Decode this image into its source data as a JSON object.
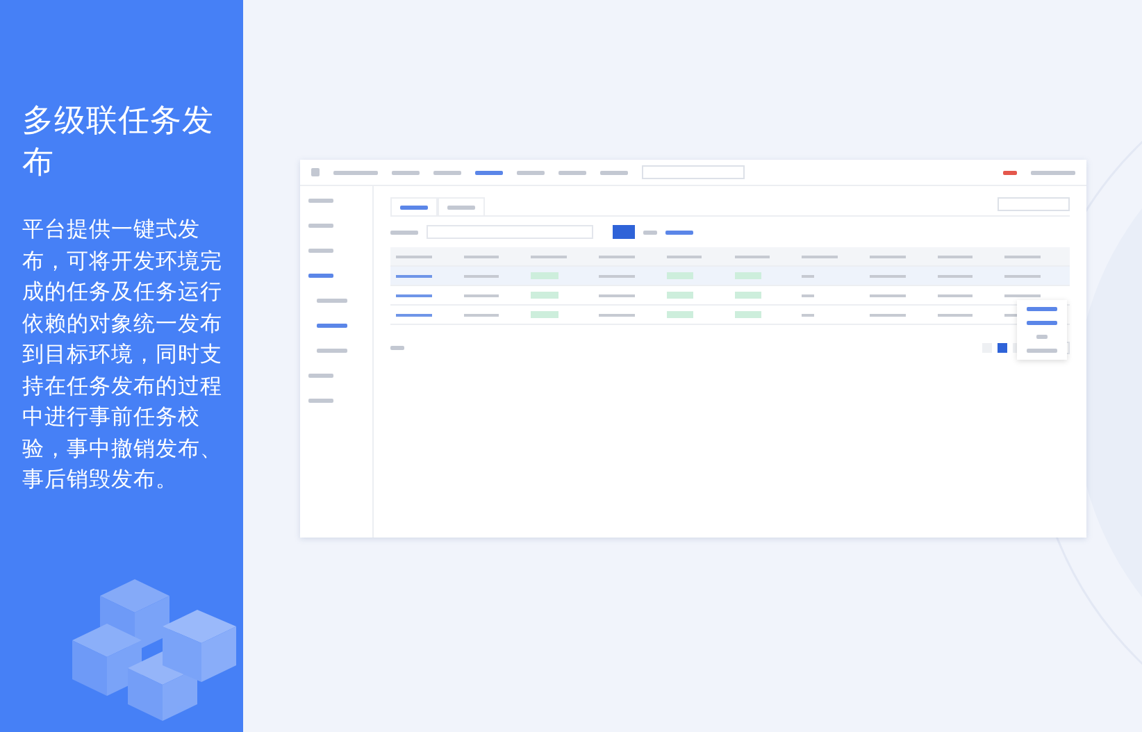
{
  "panel": {
    "title": "多级联任务发布",
    "description": "平台提供一键式发布，可将开发环境完成的任务及任务运行依赖的对象统一发布到目标环境，同时支持在任务发布的过程中进行事前任务校验，事中撤销发布、事后销毁发布。"
  }
}
